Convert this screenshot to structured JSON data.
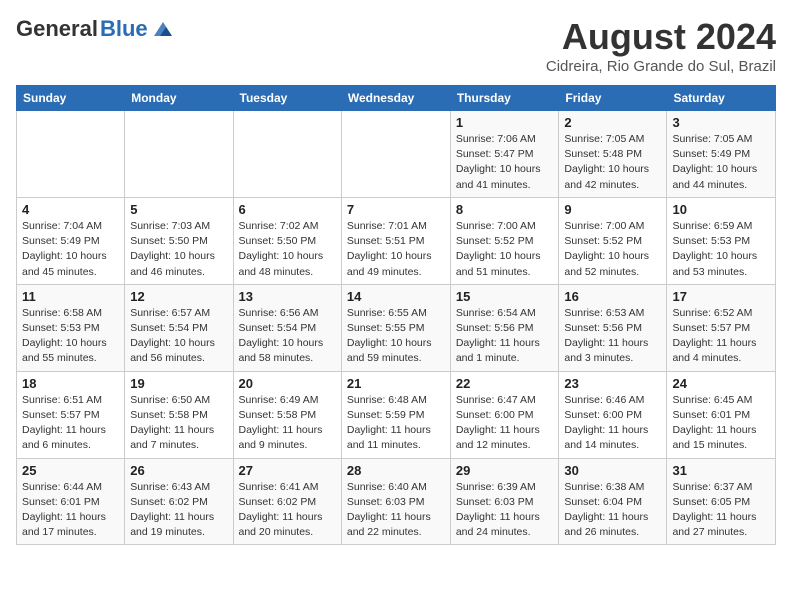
{
  "header": {
    "logo_general": "General",
    "logo_blue": "Blue",
    "month_year": "August 2024",
    "location": "Cidreira, Rio Grande do Sul, Brazil"
  },
  "weekdays": [
    "Sunday",
    "Monday",
    "Tuesday",
    "Wednesday",
    "Thursday",
    "Friday",
    "Saturday"
  ],
  "weeks": [
    [
      {
        "day": "",
        "sunrise": "",
        "sunset": "",
        "daylight": ""
      },
      {
        "day": "",
        "sunrise": "",
        "sunset": "",
        "daylight": ""
      },
      {
        "day": "",
        "sunrise": "",
        "sunset": "",
        "daylight": ""
      },
      {
        "day": "",
        "sunrise": "",
        "sunset": "",
        "daylight": ""
      },
      {
        "day": "1",
        "sunrise": "Sunrise: 7:06 AM",
        "sunset": "Sunset: 5:47 PM",
        "daylight": "Daylight: 10 hours and 41 minutes."
      },
      {
        "day": "2",
        "sunrise": "Sunrise: 7:05 AM",
        "sunset": "Sunset: 5:48 PM",
        "daylight": "Daylight: 10 hours and 42 minutes."
      },
      {
        "day": "3",
        "sunrise": "Sunrise: 7:05 AM",
        "sunset": "Sunset: 5:49 PM",
        "daylight": "Daylight: 10 hours and 44 minutes."
      }
    ],
    [
      {
        "day": "4",
        "sunrise": "Sunrise: 7:04 AM",
        "sunset": "Sunset: 5:49 PM",
        "daylight": "Daylight: 10 hours and 45 minutes."
      },
      {
        "day": "5",
        "sunrise": "Sunrise: 7:03 AM",
        "sunset": "Sunset: 5:50 PM",
        "daylight": "Daylight: 10 hours and 46 minutes."
      },
      {
        "day": "6",
        "sunrise": "Sunrise: 7:02 AM",
        "sunset": "Sunset: 5:50 PM",
        "daylight": "Daylight: 10 hours and 48 minutes."
      },
      {
        "day": "7",
        "sunrise": "Sunrise: 7:01 AM",
        "sunset": "Sunset: 5:51 PM",
        "daylight": "Daylight: 10 hours and 49 minutes."
      },
      {
        "day": "8",
        "sunrise": "Sunrise: 7:00 AM",
        "sunset": "Sunset: 5:52 PM",
        "daylight": "Daylight: 10 hours and 51 minutes."
      },
      {
        "day": "9",
        "sunrise": "Sunrise: 7:00 AM",
        "sunset": "Sunset: 5:52 PM",
        "daylight": "Daylight: 10 hours and 52 minutes."
      },
      {
        "day": "10",
        "sunrise": "Sunrise: 6:59 AM",
        "sunset": "Sunset: 5:53 PM",
        "daylight": "Daylight: 10 hours and 53 minutes."
      }
    ],
    [
      {
        "day": "11",
        "sunrise": "Sunrise: 6:58 AM",
        "sunset": "Sunset: 5:53 PM",
        "daylight": "Daylight: 10 hours and 55 minutes."
      },
      {
        "day": "12",
        "sunrise": "Sunrise: 6:57 AM",
        "sunset": "Sunset: 5:54 PM",
        "daylight": "Daylight: 10 hours and 56 minutes."
      },
      {
        "day": "13",
        "sunrise": "Sunrise: 6:56 AM",
        "sunset": "Sunset: 5:54 PM",
        "daylight": "Daylight: 10 hours and 58 minutes."
      },
      {
        "day": "14",
        "sunrise": "Sunrise: 6:55 AM",
        "sunset": "Sunset: 5:55 PM",
        "daylight": "Daylight: 10 hours and 59 minutes."
      },
      {
        "day": "15",
        "sunrise": "Sunrise: 6:54 AM",
        "sunset": "Sunset: 5:56 PM",
        "daylight": "Daylight: 11 hours and 1 minute."
      },
      {
        "day": "16",
        "sunrise": "Sunrise: 6:53 AM",
        "sunset": "Sunset: 5:56 PM",
        "daylight": "Daylight: 11 hours and 3 minutes."
      },
      {
        "day": "17",
        "sunrise": "Sunrise: 6:52 AM",
        "sunset": "Sunset: 5:57 PM",
        "daylight": "Daylight: 11 hours and 4 minutes."
      }
    ],
    [
      {
        "day": "18",
        "sunrise": "Sunrise: 6:51 AM",
        "sunset": "Sunset: 5:57 PM",
        "daylight": "Daylight: 11 hours and 6 minutes."
      },
      {
        "day": "19",
        "sunrise": "Sunrise: 6:50 AM",
        "sunset": "Sunset: 5:58 PM",
        "daylight": "Daylight: 11 hours and 7 minutes."
      },
      {
        "day": "20",
        "sunrise": "Sunrise: 6:49 AM",
        "sunset": "Sunset: 5:58 PM",
        "daylight": "Daylight: 11 hours and 9 minutes."
      },
      {
        "day": "21",
        "sunrise": "Sunrise: 6:48 AM",
        "sunset": "Sunset: 5:59 PM",
        "daylight": "Daylight: 11 hours and 11 minutes."
      },
      {
        "day": "22",
        "sunrise": "Sunrise: 6:47 AM",
        "sunset": "Sunset: 6:00 PM",
        "daylight": "Daylight: 11 hours and 12 minutes."
      },
      {
        "day": "23",
        "sunrise": "Sunrise: 6:46 AM",
        "sunset": "Sunset: 6:00 PM",
        "daylight": "Daylight: 11 hours and 14 minutes."
      },
      {
        "day": "24",
        "sunrise": "Sunrise: 6:45 AM",
        "sunset": "Sunset: 6:01 PM",
        "daylight": "Daylight: 11 hours and 15 minutes."
      }
    ],
    [
      {
        "day": "25",
        "sunrise": "Sunrise: 6:44 AM",
        "sunset": "Sunset: 6:01 PM",
        "daylight": "Daylight: 11 hours and 17 minutes."
      },
      {
        "day": "26",
        "sunrise": "Sunrise: 6:43 AM",
        "sunset": "Sunset: 6:02 PM",
        "daylight": "Daylight: 11 hours and 19 minutes."
      },
      {
        "day": "27",
        "sunrise": "Sunrise: 6:41 AM",
        "sunset": "Sunset: 6:02 PM",
        "daylight": "Daylight: 11 hours and 20 minutes."
      },
      {
        "day": "28",
        "sunrise": "Sunrise: 6:40 AM",
        "sunset": "Sunset: 6:03 PM",
        "daylight": "Daylight: 11 hours and 22 minutes."
      },
      {
        "day": "29",
        "sunrise": "Sunrise: 6:39 AM",
        "sunset": "Sunset: 6:03 PM",
        "daylight": "Daylight: 11 hours and 24 minutes."
      },
      {
        "day": "30",
        "sunrise": "Sunrise: 6:38 AM",
        "sunset": "Sunset: 6:04 PM",
        "daylight": "Daylight: 11 hours and 26 minutes."
      },
      {
        "day": "31",
        "sunrise": "Sunrise: 6:37 AM",
        "sunset": "Sunset: 6:05 PM",
        "daylight": "Daylight: 11 hours and 27 minutes."
      }
    ]
  ]
}
